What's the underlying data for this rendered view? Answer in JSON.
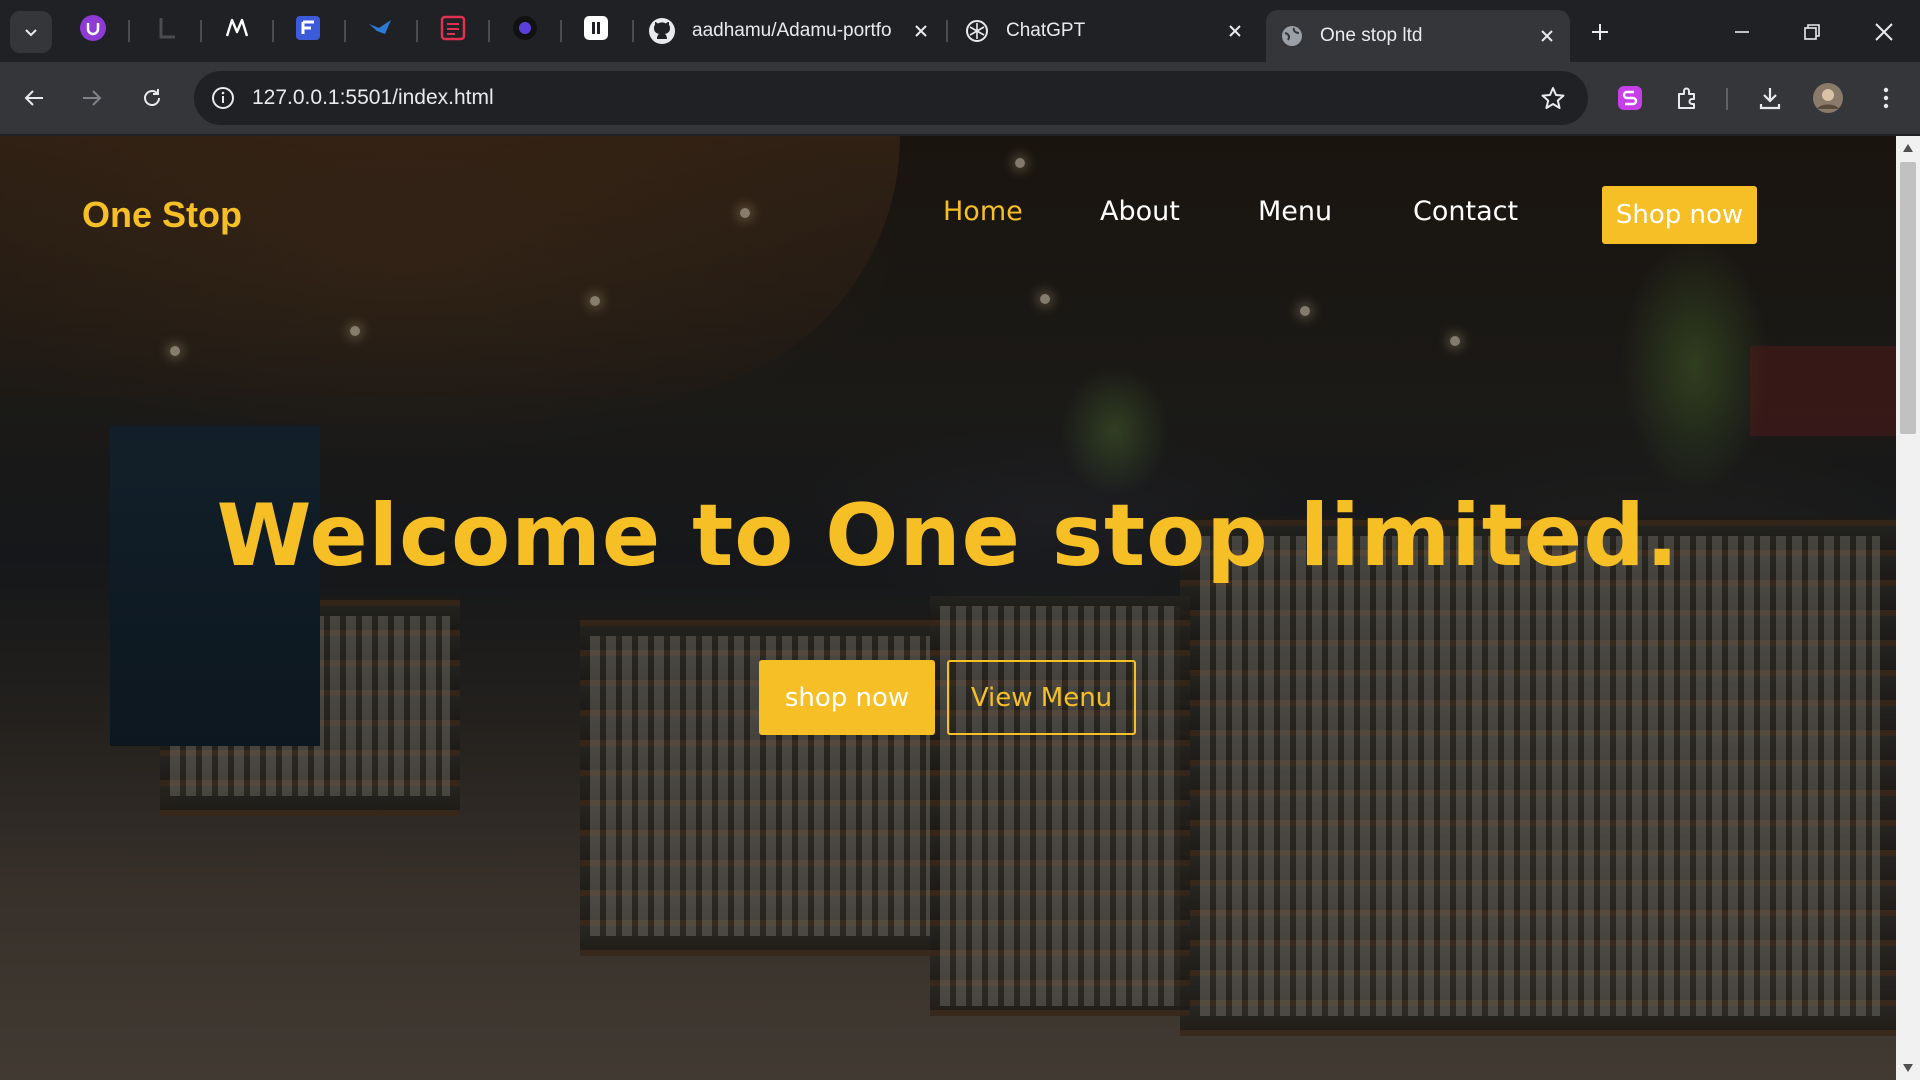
{
  "browser": {
    "tabs": [
      {
        "title": "aadhamu/Adamu-portfo",
        "icon": "github-icon"
      },
      {
        "title": "ChatGPT",
        "icon": "chatgpt-icon"
      },
      {
        "title": "One stop ltd",
        "icon": "globe-icon",
        "active": true
      }
    ],
    "url": "127.0.0.1:5501/index.html"
  },
  "site": {
    "logo": "One Stop",
    "nav": [
      {
        "label": "Home",
        "active": true
      },
      {
        "label": "About"
      },
      {
        "label": "Menu"
      },
      {
        "label": "Contact"
      }
    ],
    "header_cta": "Shop now",
    "hero_title": "Welcome to One stop limited.",
    "hero_primary_button": "shop now",
    "hero_secondary_button": "View Menu"
  },
  "colors": {
    "accent": "#f6bf26",
    "chrome_dark": "#202124",
    "chrome_toolbar": "#35363a"
  }
}
